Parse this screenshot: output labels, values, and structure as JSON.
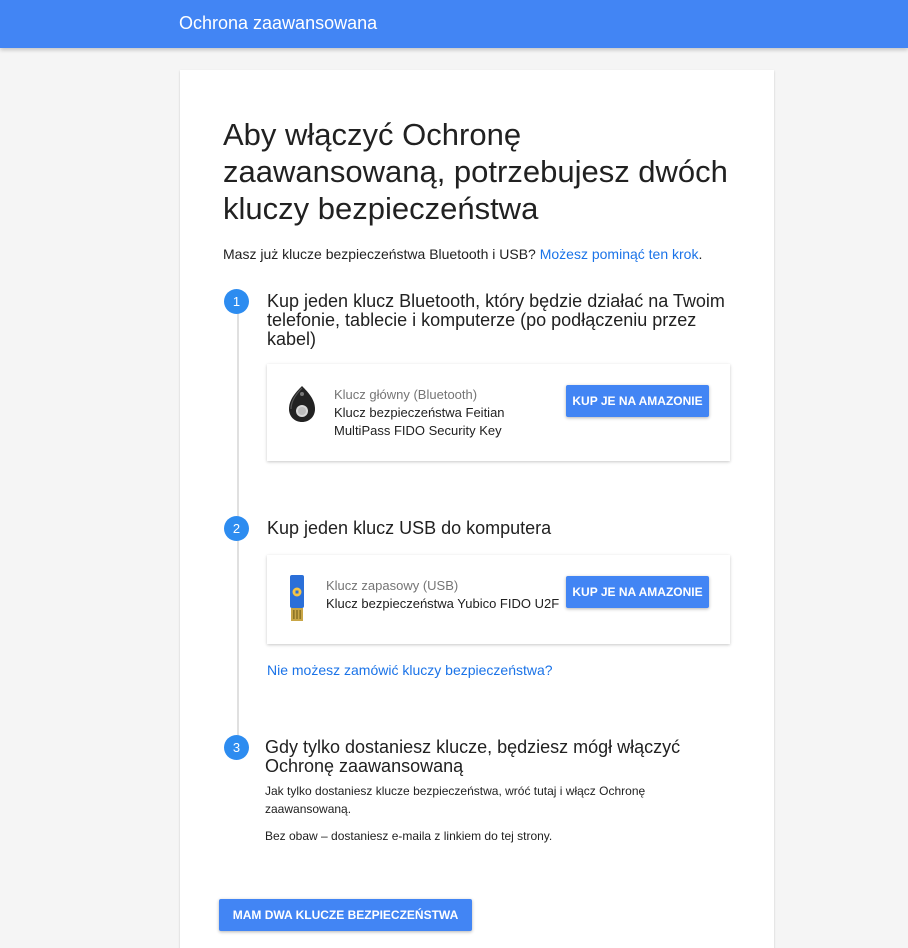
{
  "topbar": {
    "title": "Ochrona zaawansowana"
  },
  "headline": "Aby włączyć Ochronę zaawansowaną, potrzebujesz dwóch kluczy bezpieczeństwa",
  "intro": {
    "text": "Masz już klucze bezpieczeństwa Bluetooth i USB? ",
    "link": "Możesz pominąć ten krok",
    "suffix": "."
  },
  "steps": [
    {
      "number": "1",
      "title": "Kup jeden klucz Bluetooth, który będzie działać na Twoim telefonie, tablecie i komputerze (po podłączeniu przez kabel)",
      "product": {
        "icon": "bluetooth-key-icon",
        "subtitle": "Klucz główny (Bluetooth)",
        "name": "Klucz bezpieczeństwa Feitian MultiPass FIDO Security Key",
        "button": "KUP JE NA AMAZONIE"
      }
    },
    {
      "number": "2",
      "title": "Kup jeden klucz USB do komputera",
      "product": {
        "icon": "usb-key-icon",
        "subtitle": "Klucz zapasowy (USB)",
        "name": "Klucz bezpieczeństwa Yubico FIDO U2F",
        "button": "KUP JE NA AMAZONIE"
      },
      "link": "Nie możesz zamówić kluczy bezpieczeństwa?"
    },
    {
      "number": "3",
      "title": "Gdy tylko dostaniesz klucze, będziesz mógł włączyć Ochronę zaawansowaną",
      "text1": "Jak tylko dostaniesz klucze bezpieczeństwa, wróć tutaj i włącz Ochronę zaawansowaną.",
      "text2": "Bez obaw – dostaniesz e-maila z linkiem do tej strony."
    }
  ],
  "main_button": "MAM DWA KLUCZE BEZPIECZEŃSTWA",
  "colors": {
    "accent": "#4285f4",
    "link": "#1a73e8",
    "step_circle": "#2d8cf0"
  }
}
